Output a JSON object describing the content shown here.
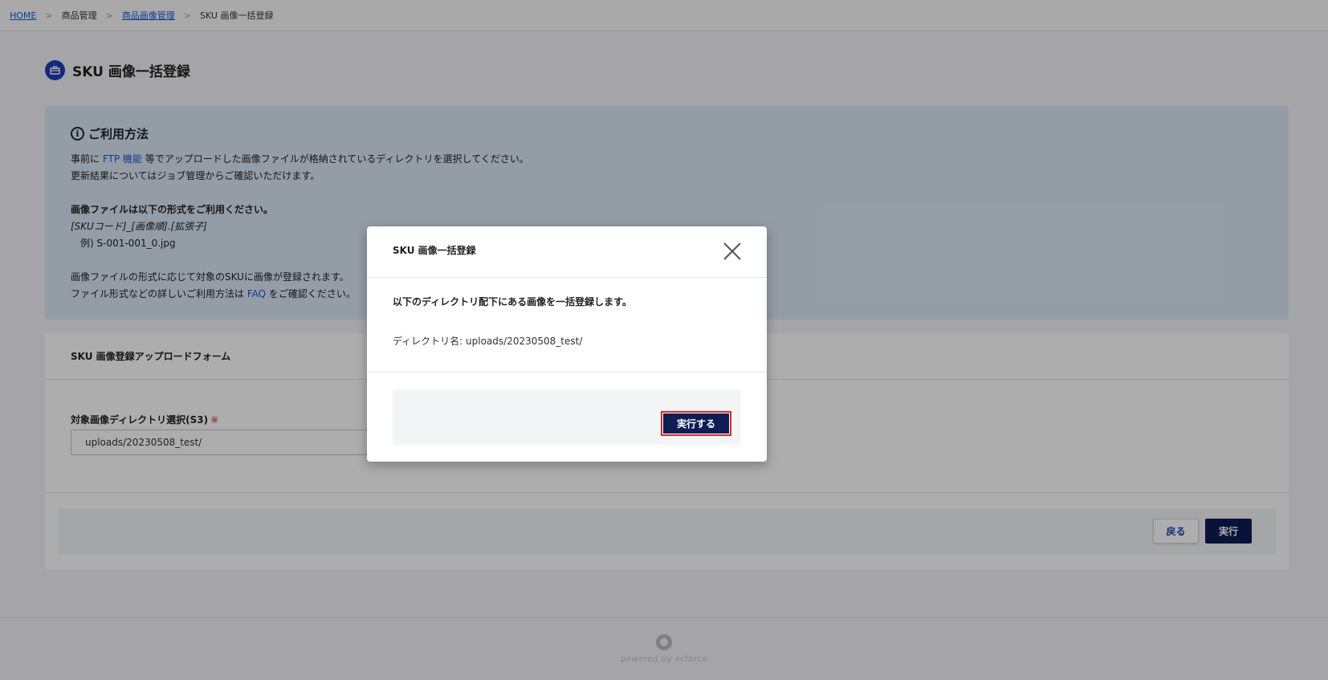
{
  "breadcrumb": {
    "home": "HOME",
    "sep": ">",
    "product_mgmt": "商品管理",
    "image_mgmt": "商品画像管理",
    "current": "SKU 画像一括登録"
  },
  "page": {
    "title": "SKU 画像一括登録",
    "icon": "briefcase-icon"
  },
  "howto": {
    "heading": "ご利用方法",
    "line1_pre": "事前に",
    "line1_link": "FTP 機能",
    "line1_post": "等でアップロードした画像ファイルが格納されているディレクトリを選択してください。",
    "line2": "更新結果についてはジョブ管理からご確認いただけます。",
    "format_title": "画像ファイルは以下の形式をご利用ください。",
    "format_pattern": "[SKUコード]_[画像順].[拡張子]",
    "format_example": "例) S-001-001_0.jpg",
    "line3": "画像ファイルの形式に応じて対象のSKUに画像が登録されます。",
    "line4_pre": "ファイル形式などの詳しいご利用方法は",
    "line4_link": "FAQ",
    "line4_post": "をご確認ください。"
  },
  "form": {
    "title": "SKU 画像登録アップロードフォーム",
    "field_label": "対象画像ディレクトリ選択(S3)",
    "required_mark": "※",
    "field_value": "uploads/20230508_test/",
    "back_label": "戻る",
    "exec_label": "実行"
  },
  "footer": {
    "powered": "powered by ecforce"
  },
  "modal": {
    "title": "SKU 画像一括登録",
    "message": "以下のディレクトリ配下にある画像を一括登録します。",
    "dir_label": "ディレクトリ名:",
    "dir_value": "uploads/20230508_test/",
    "confirm_label": "実行する"
  },
  "colors": {
    "accent": "#1a3fb8",
    "primary_button": "#0e1d54",
    "highlight_border": "#e02424",
    "info_bg": "#dbe7f5"
  }
}
